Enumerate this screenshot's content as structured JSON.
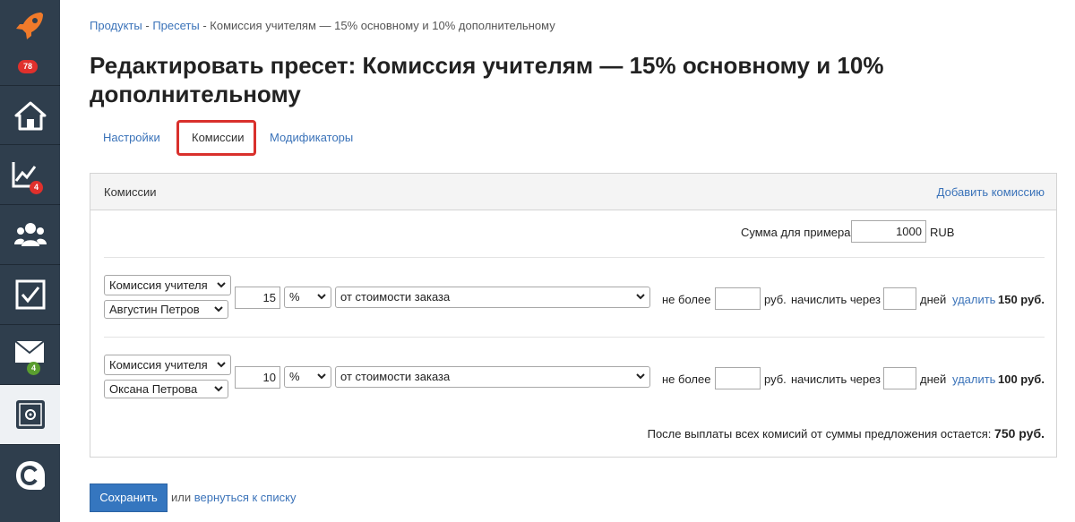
{
  "sidebar": {
    "top_badge": "78",
    "items": [
      {
        "icon": "rocket-icon"
      },
      {
        "icon": "home-icon"
      },
      {
        "icon": "chart-icon",
        "badge": "4"
      },
      {
        "icon": "users-icon"
      },
      {
        "icon": "checkbox-icon"
      },
      {
        "icon": "mail-icon",
        "badge": "4"
      },
      {
        "icon": "safe-icon"
      },
      {
        "icon": "logo-c-icon"
      }
    ]
  },
  "breadcrumb": {
    "items": [
      "Продукты",
      "Пресеты"
    ],
    "separator": " - ",
    "current": "Комиссия учителям — 15% основному и 10% дополнительному"
  },
  "page_title": "Редактировать пресет: Комиссия учителям — 15% основному и 10% дополнительному",
  "tabs": [
    {
      "label": "Настройки",
      "active": false
    },
    {
      "label": "Комиссии",
      "active": true
    },
    {
      "label": "Модификаторы",
      "active": false
    }
  ],
  "panel": {
    "title": "Комиссии",
    "add_link": "Добавить комиссию",
    "example_label": "Сумма для примера",
    "example_value": "1000",
    "example_currency": "RUB",
    "rows": [
      {
        "type": "Комиссия учителя",
        "person": "Августин Петров",
        "amount": "15",
        "unit": "%",
        "base": "от стоимости заказа",
        "max_label": "не более",
        "max_value": "",
        "currency_label": "руб.",
        "delay_label": "начислить через",
        "delay_value": "",
        "days_label": "дней",
        "delete_label": "удалить",
        "result": "150 руб."
      },
      {
        "type": "Комиссия учителя",
        "person": "Оксана Петрова",
        "amount": "10",
        "unit": "%",
        "base": "от стоимости заказа",
        "max_label": "не более",
        "max_value": "",
        "currency_label": "руб.",
        "delay_label": "начислить через",
        "delay_value": "",
        "days_label": "дней",
        "delete_label": "удалить",
        "result": "100 руб."
      }
    ],
    "remaining_label": "После выплаты всех комисий от суммы предложения остается:",
    "remaining_value": "750 руб."
  },
  "footer": {
    "save_label": "Сохранить",
    "or_label": "или",
    "back_link": "вернуться к списку"
  },
  "colors": {
    "sidebar_bg": "#2f3e4d",
    "link": "#3b73b9",
    "badge_red": "#e0302c",
    "badge_green": "#5a9e2f",
    "highlight": "#d9302c",
    "primary_button": "#3576bf"
  }
}
